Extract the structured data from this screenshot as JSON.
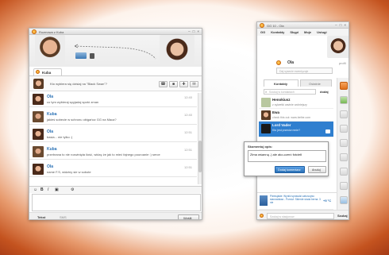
{
  "chat": {
    "title": "Rozmowa z Kuba",
    "tab_label": "Kuba",
    "status_desc": "Kto wybiera się dzisiaj na \"Black Swan\"?",
    "messages": [
      {
        "name": "Ola",
        "time": "12:40",
        "text": "co tym wybieraj spyjadaj spotó zman"
      },
      {
        "name": "Kuba",
        "time": "12:40",
        "text": "jakieś sobecie w schronu obigańcz GG na Maca?"
      },
      {
        "name": "Ola",
        "time": "12:51",
        "text": "basia... nie tylko :)"
      },
      {
        "name": "Kuba",
        "time": "12:51",
        "text": "przebrana to nie rozwinięta ilość, widzę że jak to mieć fajnego pouroanie :) serce"
      },
      {
        "name": "Ola",
        "time": "12:51",
        "text": "name F.S, widziny sie w sobote"
      }
    ],
    "bottom_tabs": [
      "Tekst",
      "SMS"
    ],
    "send_label": "Wyślij"
  },
  "main": {
    "title": "GG 10 - Ola",
    "menu": [
      "GG",
      "Kontakty",
      "Skąpi",
      "Moje",
      "Ustugi"
    ],
    "user_name": "Ola",
    "profile_label": "profil",
    "desc_placeholder": "Daj sysecie ewentyzuje",
    "tabs": [
      "Kontakty",
      "Ostatnie"
    ],
    "search_placeholder": "Szukaj w kontaktach",
    "add_label": "dodaj",
    "contacts": [
      {
        "name": "Henokiusz",
        "desc": "z sylwetki ważnie wolniejszy"
      },
      {
        "name": "Ewa",
        "desc": "check this out: www.bethe.com"
      },
      {
        "name": "Lord Vader",
        "desc": "Kto jest przeciw mnie?"
      },
      {
        "name": "Jakub",
        "desc": ""
      }
    ],
    "popup": {
      "title": "Skomentuj opis:",
      "value": "Zima wśanną -) ale ako-czerć fotciełł",
      "ok_label": "Dodaj komentarz",
      "cancel_label": "Anuluj"
    },
    "ad": {
      "text": "Pierksjakie: Wyniki sprawdzi zatrzczyko stanowisław - Pomóż: Sklerde studa berna. 3 nie",
      "badge": "+5 °C"
    },
    "bottom_search_placeholder": "Szukaj w stacjonow",
    "bottom_button": "Szukaj"
  },
  "colors": {
    "accent": "#2a71b5",
    "selected": "#2f7fcf",
    "brand_orange": "#f08a1c"
  }
}
